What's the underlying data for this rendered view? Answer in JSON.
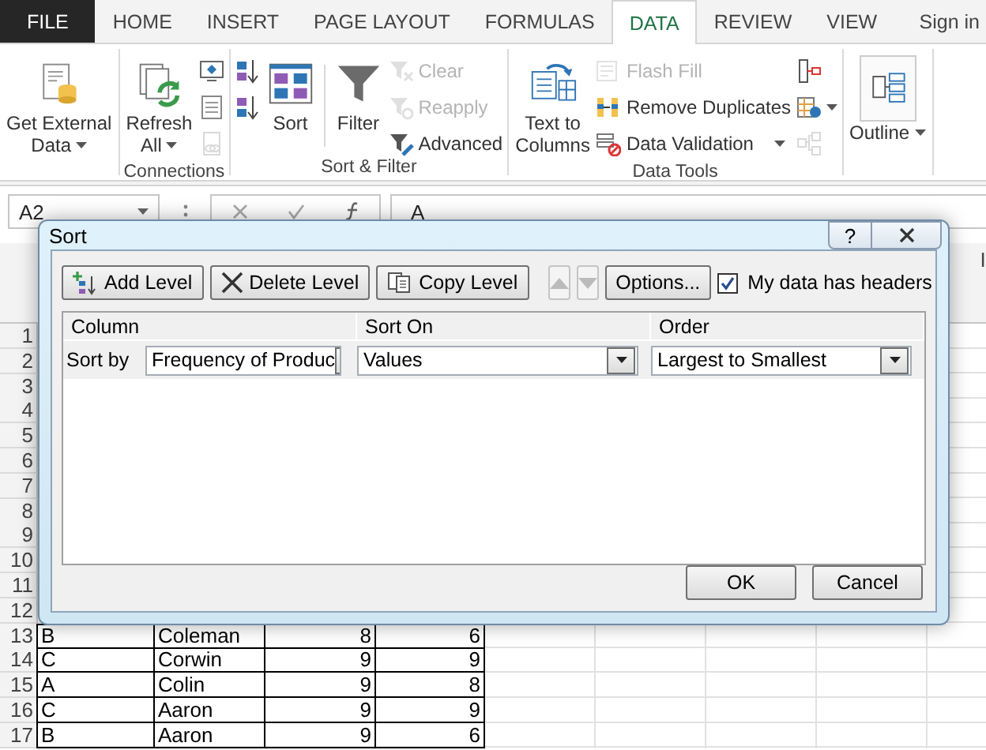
{
  "ribbon_tabs": [
    {
      "label": "FILE",
      "kind": "file",
      "selected": false
    },
    {
      "label": "HOME",
      "kind": "tab",
      "selected": false
    },
    {
      "label": "INSERT",
      "kind": "tab",
      "selected": false
    },
    {
      "label": "PAGE LAYOUT",
      "kind": "tab",
      "selected": false
    },
    {
      "label": "FORMULAS",
      "kind": "tab",
      "selected": false
    },
    {
      "label": "DATA",
      "kind": "tab",
      "selected": true
    },
    {
      "label": "REVIEW",
      "kind": "tab",
      "selected": false
    },
    {
      "label": "VIEW",
      "kind": "tab",
      "selected": false
    }
  ],
  "sign_in": "Sign in",
  "ribbon_groups": [
    {
      "items": [
        {
          "kind": "large",
          "lines": [
            "Get External",
            "Data"
          ],
          "dropdown": true,
          "disabled": false
        }
      ]
    },
    {
      "label": "Connections",
      "items": [
        {
          "kind": "large",
          "lines": [
            "Refresh",
            "All"
          ],
          "dropdown": true,
          "disabled": false
        },
        {
          "kind": "stack",
          "items": [
            {
              "disabled": false
            },
            {
              "disabled": false
            },
            {
              "disabled": true
            }
          ]
        }
      ]
    },
    {
      "label": "Sort & Filter",
      "items": [
        {
          "kind": "stack",
          "items": [
            {
              "disabled": false
            },
            {
              "disabled": false
            }
          ]
        },
        {
          "kind": "large",
          "lines": [
            "Sort"
          ],
          "dropdown": false,
          "disabled": false
        },
        {
          "kind": "separator"
        },
        {
          "kind": "large",
          "lines": [
            "Filter"
          ],
          "dropdown": false,
          "disabled": false
        },
        {
          "kind": "stack",
          "items": [
            {
              "label": "Clear",
              "disabled": true
            },
            {
              "label": "Reapply",
              "disabled": true
            },
            {
              "label": "Advanced",
              "disabled": false
            }
          ]
        }
      ]
    },
    {
      "label": "Data Tools",
      "items": [
        {
          "kind": "large",
          "lines": [
            "Text to",
            "Columns"
          ],
          "dropdown": false,
          "disabled": false
        },
        {
          "kind": "stack",
          "items": [
            {
              "label": "Flash Fill",
              "disabled": true
            },
            {
              "label": "Remove Duplicates",
              "disabled": false
            },
            {
              "label": "Data Validation",
              "disabled": false,
              "dropdown": true
            }
          ]
        },
        {
          "kind": "stack",
          "items": [
            {
              "disabled": false
            },
            {
              "disabled": false,
              "dropdown": true
            },
            {
              "disabled": true
            }
          ]
        }
      ]
    },
    {
      "items": [
        {
          "kind": "large",
          "lines": [
            "Outline"
          ],
          "dropdown": true,
          "disabled": false,
          "boxed": true
        }
      ]
    }
  ],
  "formula_bar": {
    "name_box": "A2",
    "value": "A"
  },
  "sheet": {
    "visible_column_header": "I",
    "rows": [
      {
        "number": "1"
      },
      {
        "number": "2"
      },
      {
        "number": "3"
      },
      {
        "number": "4"
      },
      {
        "number": "5"
      },
      {
        "number": "6"
      },
      {
        "number": "7"
      },
      {
        "number": "8"
      },
      {
        "number": "9"
      },
      {
        "number": "10"
      },
      {
        "number": "11"
      },
      {
        "number": "12"
      },
      {
        "number": "13",
        "cells": [
          "B",
          "Coleman",
          "8",
          "6"
        ]
      },
      {
        "number": "14",
        "cells": [
          "C",
          "Corwin",
          "9",
          "9"
        ]
      },
      {
        "number": "15",
        "cells": [
          "A",
          "Colin",
          "9",
          "8"
        ]
      },
      {
        "number": "16",
        "cells": [
          "C",
          "Aaron",
          "9",
          "9"
        ]
      },
      {
        "number": "17",
        "cells": [
          "B",
          "Aaron",
          "9",
          "6"
        ]
      }
    ]
  },
  "sort_dialog": {
    "title": "Sort",
    "help_button": "?",
    "toolbar": [
      {
        "kind": "button",
        "label": "Add Level",
        "disabled": false
      },
      {
        "kind": "button",
        "label": "Delete Level",
        "disabled": false
      },
      {
        "kind": "button",
        "label": "Copy Level",
        "disabled": false
      },
      {
        "kind": "move",
        "pointing_up": true,
        "disabled": true
      },
      {
        "kind": "move",
        "pointing_up": false,
        "disabled": true
      },
      {
        "kind": "button",
        "label": "Options...",
        "disabled": false
      }
    ],
    "headers_checkbox": {
      "label": "My data has headers",
      "checked": true
    },
    "columns": [
      "Column",
      "Sort On",
      "Order"
    ],
    "levels": [
      {
        "label": "Sort by",
        "column": "Frequency of Produc",
        "sort_on": "Values",
        "order": "Largest to Smallest"
      }
    ],
    "buttons": [
      "OK",
      "Cancel"
    ]
  }
}
